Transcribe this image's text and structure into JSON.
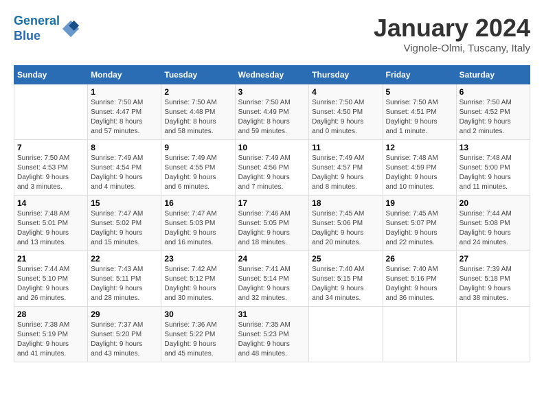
{
  "header": {
    "logo_line1": "General",
    "logo_line2": "Blue",
    "month_title": "January 2024",
    "subtitle": "Vignole-Olmi, Tuscany, Italy"
  },
  "weekdays": [
    "Sunday",
    "Monday",
    "Tuesday",
    "Wednesday",
    "Thursday",
    "Friday",
    "Saturday"
  ],
  "weeks": [
    [
      {
        "day": "",
        "detail": ""
      },
      {
        "day": "1",
        "detail": "Sunrise: 7:50 AM\nSunset: 4:47 PM\nDaylight: 8 hours\nand 57 minutes."
      },
      {
        "day": "2",
        "detail": "Sunrise: 7:50 AM\nSunset: 4:48 PM\nDaylight: 8 hours\nand 58 minutes."
      },
      {
        "day": "3",
        "detail": "Sunrise: 7:50 AM\nSunset: 4:49 PM\nDaylight: 8 hours\nand 59 minutes."
      },
      {
        "day": "4",
        "detail": "Sunrise: 7:50 AM\nSunset: 4:50 PM\nDaylight: 9 hours\nand 0 minutes."
      },
      {
        "day": "5",
        "detail": "Sunrise: 7:50 AM\nSunset: 4:51 PM\nDaylight: 9 hours\nand 1 minute."
      },
      {
        "day": "6",
        "detail": "Sunrise: 7:50 AM\nSunset: 4:52 PM\nDaylight: 9 hours\nand 2 minutes."
      }
    ],
    [
      {
        "day": "7",
        "detail": "Sunrise: 7:50 AM\nSunset: 4:53 PM\nDaylight: 9 hours\nand 3 minutes."
      },
      {
        "day": "8",
        "detail": "Sunrise: 7:49 AM\nSunset: 4:54 PM\nDaylight: 9 hours\nand 4 minutes."
      },
      {
        "day": "9",
        "detail": "Sunrise: 7:49 AM\nSunset: 4:55 PM\nDaylight: 9 hours\nand 6 minutes."
      },
      {
        "day": "10",
        "detail": "Sunrise: 7:49 AM\nSunset: 4:56 PM\nDaylight: 9 hours\nand 7 minutes."
      },
      {
        "day": "11",
        "detail": "Sunrise: 7:49 AM\nSunset: 4:57 PM\nDaylight: 9 hours\nand 8 minutes."
      },
      {
        "day": "12",
        "detail": "Sunrise: 7:48 AM\nSunset: 4:59 PM\nDaylight: 9 hours\nand 10 minutes."
      },
      {
        "day": "13",
        "detail": "Sunrise: 7:48 AM\nSunset: 5:00 PM\nDaylight: 9 hours\nand 11 minutes."
      }
    ],
    [
      {
        "day": "14",
        "detail": "Sunrise: 7:48 AM\nSunset: 5:01 PM\nDaylight: 9 hours\nand 13 minutes."
      },
      {
        "day": "15",
        "detail": "Sunrise: 7:47 AM\nSunset: 5:02 PM\nDaylight: 9 hours\nand 15 minutes."
      },
      {
        "day": "16",
        "detail": "Sunrise: 7:47 AM\nSunset: 5:03 PM\nDaylight: 9 hours\nand 16 minutes."
      },
      {
        "day": "17",
        "detail": "Sunrise: 7:46 AM\nSunset: 5:05 PM\nDaylight: 9 hours\nand 18 minutes."
      },
      {
        "day": "18",
        "detail": "Sunrise: 7:45 AM\nSunset: 5:06 PM\nDaylight: 9 hours\nand 20 minutes."
      },
      {
        "day": "19",
        "detail": "Sunrise: 7:45 AM\nSunset: 5:07 PM\nDaylight: 9 hours\nand 22 minutes."
      },
      {
        "day": "20",
        "detail": "Sunrise: 7:44 AM\nSunset: 5:08 PM\nDaylight: 9 hours\nand 24 minutes."
      }
    ],
    [
      {
        "day": "21",
        "detail": "Sunrise: 7:44 AM\nSunset: 5:10 PM\nDaylight: 9 hours\nand 26 minutes."
      },
      {
        "day": "22",
        "detail": "Sunrise: 7:43 AM\nSunset: 5:11 PM\nDaylight: 9 hours\nand 28 minutes."
      },
      {
        "day": "23",
        "detail": "Sunrise: 7:42 AM\nSunset: 5:12 PM\nDaylight: 9 hours\nand 30 minutes."
      },
      {
        "day": "24",
        "detail": "Sunrise: 7:41 AM\nSunset: 5:14 PM\nDaylight: 9 hours\nand 32 minutes."
      },
      {
        "day": "25",
        "detail": "Sunrise: 7:40 AM\nSunset: 5:15 PM\nDaylight: 9 hours\nand 34 minutes."
      },
      {
        "day": "26",
        "detail": "Sunrise: 7:40 AM\nSunset: 5:16 PM\nDaylight: 9 hours\nand 36 minutes."
      },
      {
        "day": "27",
        "detail": "Sunrise: 7:39 AM\nSunset: 5:18 PM\nDaylight: 9 hours\nand 38 minutes."
      }
    ],
    [
      {
        "day": "28",
        "detail": "Sunrise: 7:38 AM\nSunset: 5:19 PM\nDaylight: 9 hours\nand 41 minutes."
      },
      {
        "day": "29",
        "detail": "Sunrise: 7:37 AM\nSunset: 5:20 PM\nDaylight: 9 hours\nand 43 minutes."
      },
      {
        "day": "30",
        "detail": "Sunrise: 7:36 AM\nSunset: 5:22 PM\nDaylight: 9 hours\nand 45 minutes."
      },
      {
        "day": "31",
        "detail": "Sunrise: 7:35 AM\nSunset: 5:23 PM\nDaylight: 9 hours\nand 48 minutes."
      },
      {
        "day": "",
        "detail": ""
      },
      {
        "day": "",
        "detail": ""
      },
      {
        "day": "",
        "detail": ""
      }
    ]
  ]
}
